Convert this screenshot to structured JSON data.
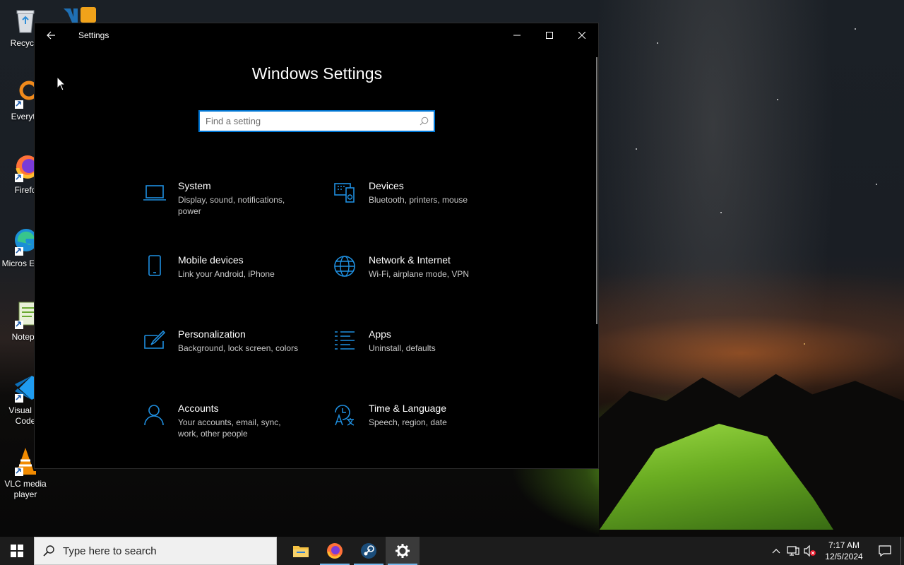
{
  "desktop": {
    "icons": [
      {
        "label": "Recycle"
      },
      {
        "label": "Everyth"
      },
      {
        "label": "Firefo"
      },
      {
        "label": "Micros Edge"
      },
      {
        "label": "Notepa"
      },
      {
        "label": "Visual St Code"
      },
      {
        "label": "VLC media player"
      }
    ]
  },
  "window": {
    "title": "Settings",
    "heading": "Windows Settings",
    "search_placeholder": "Find a setting",
    "categories": [
      {
        "title": "System",
        "desc": "Display, sound, notifications, power",
        "icon": "laptop-icon"
      },
      {
        "title": "Devices",
        "desc": "Bluetooth, printers, mouse",
        "icon": "devices-icon"
      },
      {
        "title": "Mobile devices",
        "desc": "Link your Android, iPhone",
        "icon": "phone-icon"
      },
      {
        "title": "Network & Internet",
        "desc": "Wi-Fi, airplane mode, VPN",
        "icon": "globe-icon"
      },
      {
        "title": "Personalization",
        "desc": "Background, lock screen, colors",
        "icon": "paint-icon"
      },
      {
        "title": "Apps",
        "desc": "Uninstall, defaults",
        "icon": "apps-list-icon"
      },
      {
        "title": "Accounts",
        "desc": "Your accounts, email, sync, work, other people",
        "icon": "person-icon"
      },
      {
        "title": "Time & Language",
        "desc": "Speech, region, date",
        "icon": "time-language-icon"
      }
    ],
    "accent": "#0078d7"
  },
  "taskbar": {
    "search_placeholder": "Type here to search",
    "time": "7:17 AM",
    "date": "12/5/2024"
  }
}
